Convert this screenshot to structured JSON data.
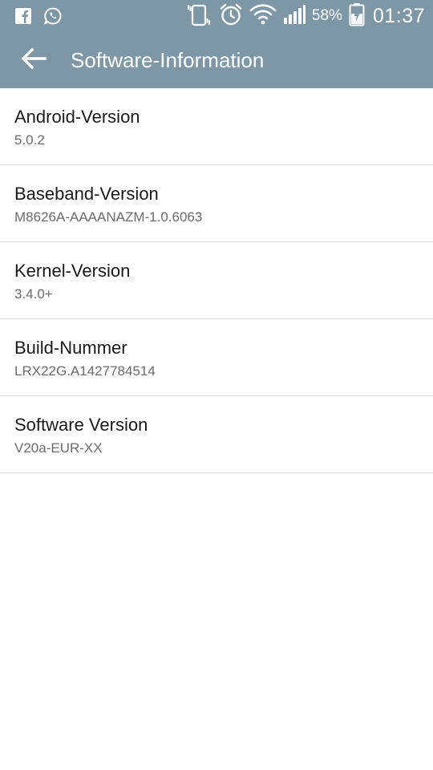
{
  "status_bar": {
    "left_icons": [
      "facebook-icon",
      "whatsapp-icon"
    ],
    "right_icons": [
      "vibrate-icon",
      "alarm-icon",
      "wifi-icon",
      "signal-icon"
    ],
    "battery_percent": "58%",
    "battery_level": 0.58,
    "battery_icon": "battery-charging-icon",
    "time": "01:37"
  },
  "app_bar": {
    "back_icon": "arrow-back-icon",
    "title": "Software-Information"
  },
  "items": [
    {
      "title": "Android-Version",
      "value": "5.0.2"
    },
    {
      "title": "Baseband-Version",
      "value": "M8626A-AAAANAZM-1.0.6063"
    },
    {
      "title": "Kernel-Version",
      "value": "3.4.0+"
    },
    {
      "title": "Build-Nummer",
      "value": "LRX22G.A1427784514"
    },
    {
      "title": "Software Version",
      "value": "V20a-EUR-XX"
    }
  ],
  "colors": {
    "header_bg": "#7d97a6",
    "header_text": "#ffffff",
    "item_title": "#1a1a1a",
    "item_value": "#6b6b6b",
    "divider": "#dcdcdc",
    "background": "#ffffff"
  }
}
